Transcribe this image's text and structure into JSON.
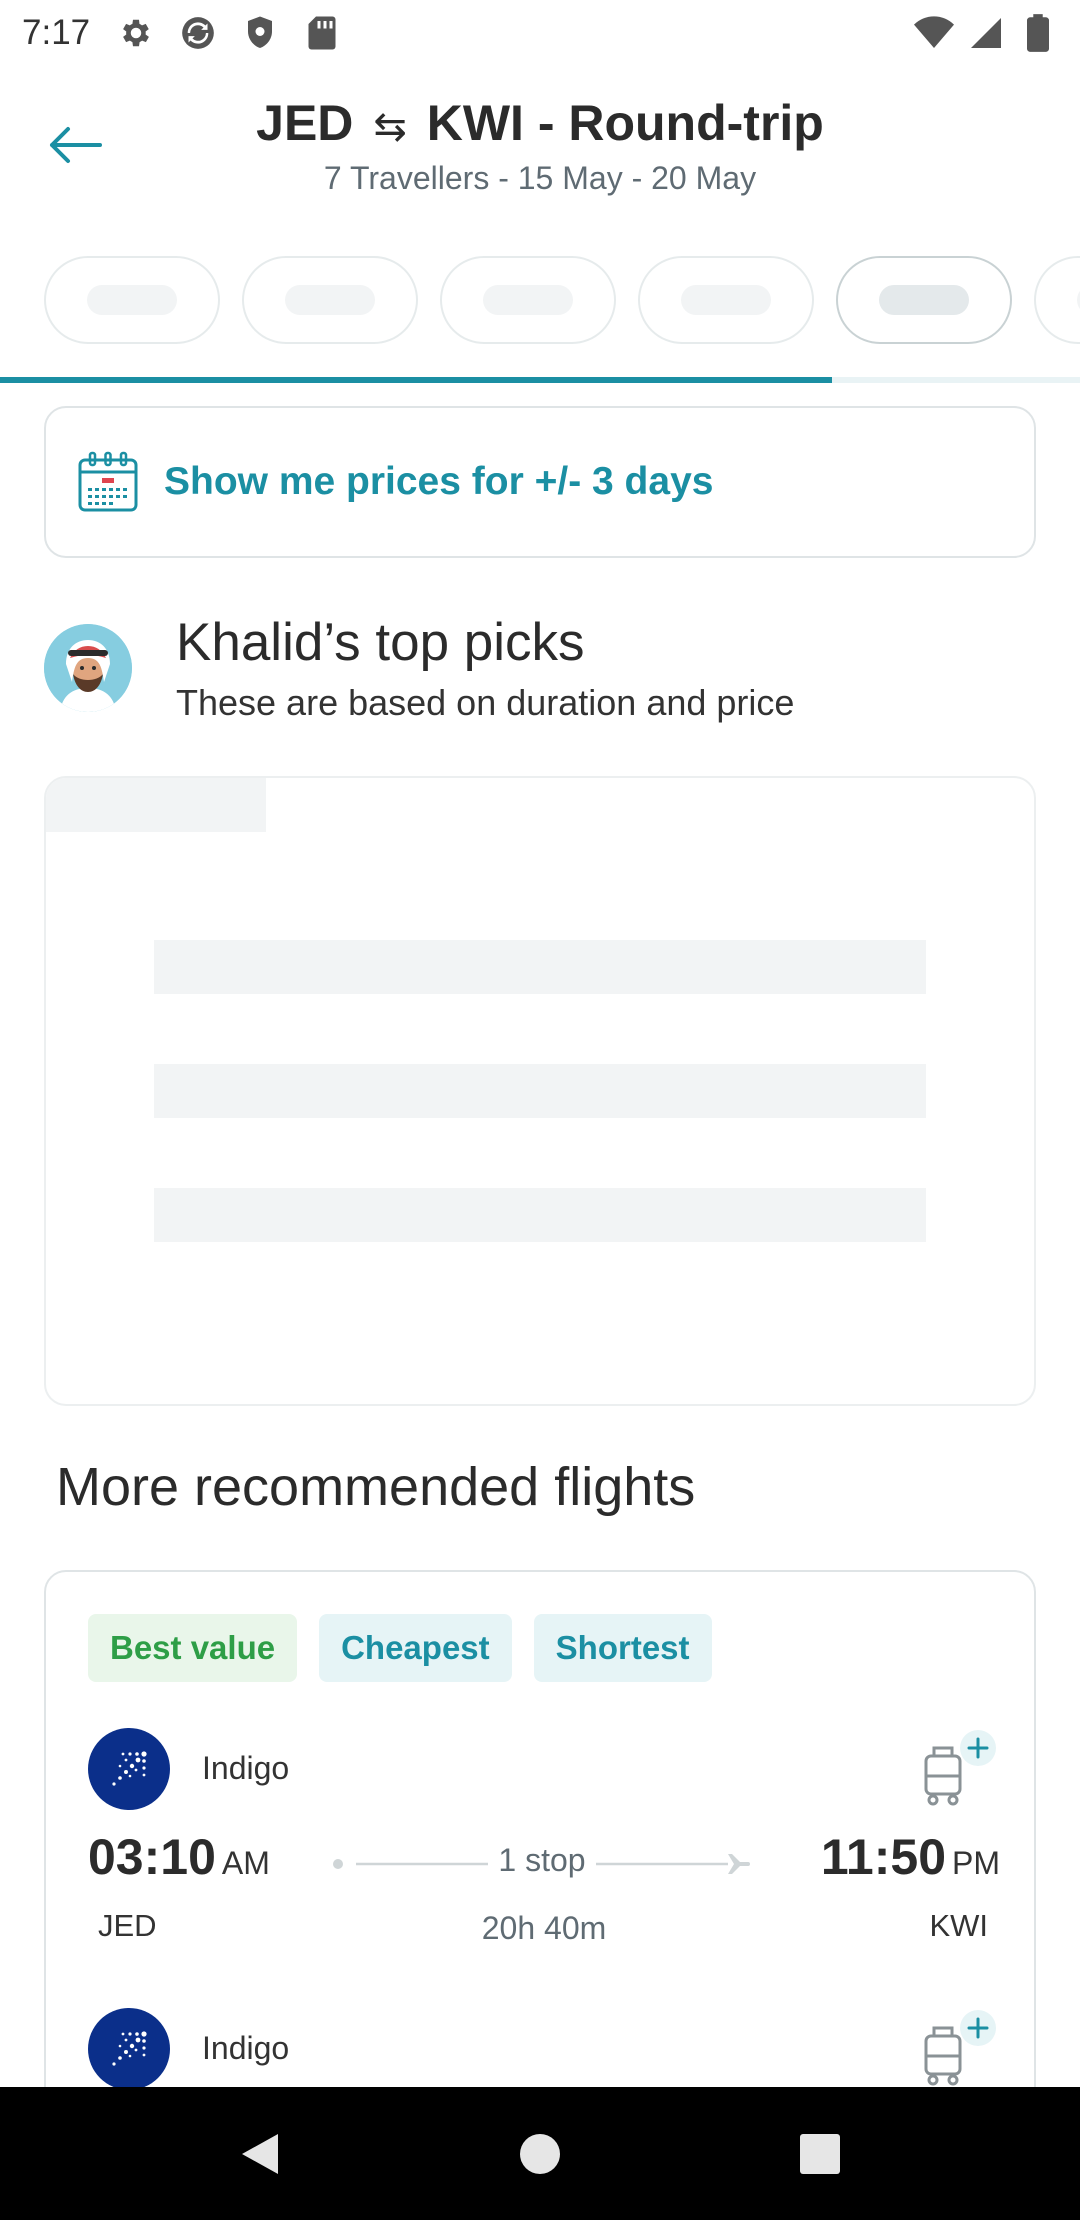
{
  "status_bar": {
    "time": "7:17",
    "left_icons": [
      "gear-icon",
      "sync-icon",
      "shield-icon",
      "sd-card-icon"
    ],
    "right_icons": [
      "wifi-icon",
      "signal-icon",
      "battery-icon"
    ]
  },
  "header": {
    "origin": "JED",
    "swap_symbol": "⇆",
    "destination": "KWI - Round-trip",
    "subtitle": "7 Travellers - 15 May - 20 May"
  },
  "date_chips": {
    "count_visible": 6,
    "selected_index": 4
  },
  "loading_progress": 0.77,
  "flexible_dates": {
    "label": "Show me prices for +/- 3 days"
  },
  "top_picks": {
    "title": "Khalid’s top picks",
    "subtitle": "These are based on duration and price"
  },
  "recommended": {
    "title": "More recommended flights",
    "tags": [
      "Best value",
      "Cheapest",
      "Shortest"
    ],
    "legs": [
      {
        "airline": "Indigo",
        "dep_time": "03:10",
        "dep_ampm": "AM",
        "dep_code": "JED",
        "stops": "1 stop",
        "duration": "20h 40m",
        "arr_time": "11:50",
        "arr_ampm": "PM",
        "arr_code": "KWI"
      },
      {
        "airline": "Indigo"
      }
    ]
  },
  "colors": {
    "accent": "#1b8fa3",
    "best_value": "#2e9e47",
    "airline_logo": "#0b2f8a"
  }
}
